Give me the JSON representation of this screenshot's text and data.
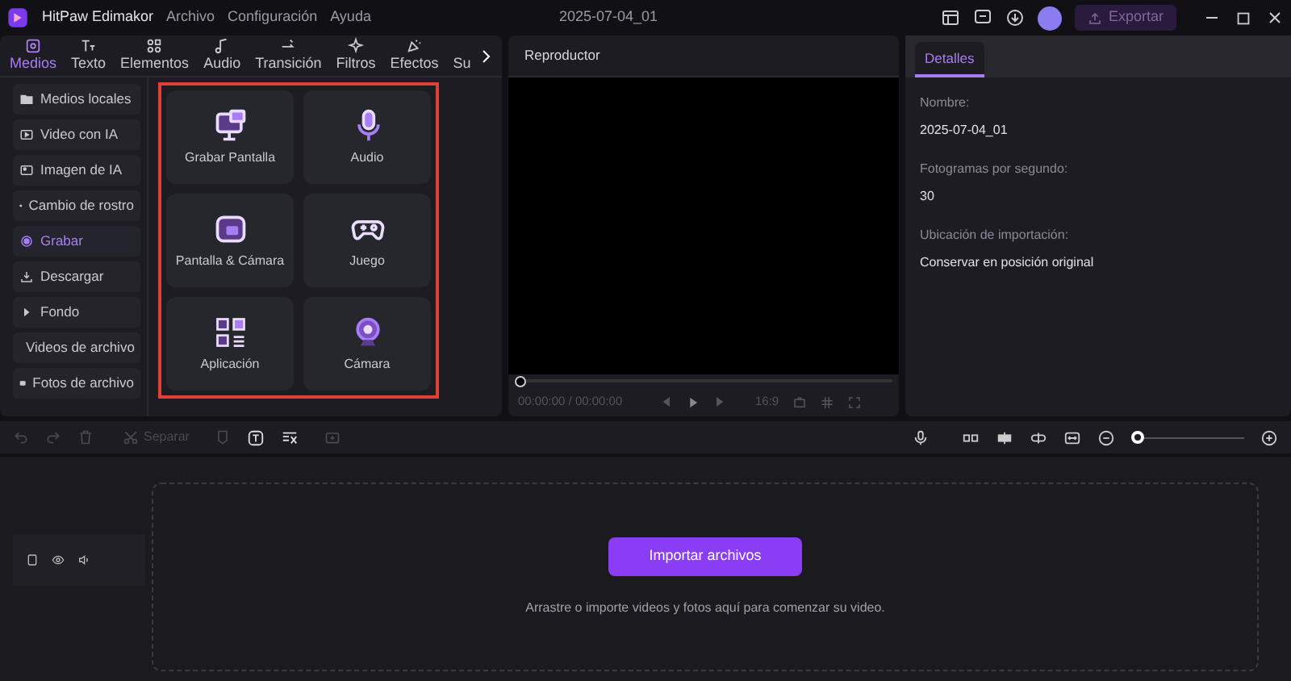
{
  "title_bar": {
    "app_name": "HitPaw Edimakor",
    "menu": [
      "Archivo",
      "Configuración",
      "Ayuda"
    ],
    "document": "2025-07-04_01",
    "export": "Exportar"
  },
  "tabs": [
    {
      "label": "Medios",
      "selected": true
    },
    {
      "label": "Texto",
      "selected": false
    },
    {
      "label": "Elementos",
      "selected": false
    },
    {
      "label": "Audio",
      "selected": false
    },
    {
      "label": "Transición",
      "selected": false
    },
    {
      "label": "Filtros",
      "selected": false
    },
    {
      "label": "Efectos",
      "selected": false
    },
    {
      "label": "Su",
      "selected": false
    }
  ],
  "sidebar": [
    {
      "label": "Medios locales",
      "selected": false
    },
    {
      "label": "Video con IA",
      "selected": false
    },
    {
      "label": "Imagen de IA",
      "selected": false
    },
    {
      "label": "Cambio de rostro",
      "selected": false
    },
    {
      "label": "Grabar",
      "selected": true
    },
    {
      "label": "Descargar",
      "selected": false
    },
    {
      "label": "Fondo",
      "selected": false
    },
    {
      "label": "Videos de archivo",
      "selected": false
    },
    {
      "label": "Fotos de archivo",
      "selected": false
    }
  ],
  "record_options": [
    {
      "label": "Grabar Pantalla",
      "kind": "screen"
    },
    {
      "label": "Audio",
      "kind": "mic"
    },
    {
      "label": "Pantalla & Cámara",
      "kind": "screencam"
    },
    {
      "label": "Juego",
      "kind": "game"
    },
    {
      "label": "Aplicación",
      "kind": "app"
    },
    {
      "label": "Cámara",
      "kind": "camera"
    }
  ],
  "player": {
    "title": "Reproductor",
    "time": "00:00:00 / 00:00:00",
    "aspect": "16:9",
    "level": 0
  },
  "details": {
    "tab": "Detalles",
    "fields": [
      {
        "label": "Nombre:",
        "value": "2025-07-04_01"
      },
      {
        "label": "Fotogramas por segundo:",
        "value": "30"
      },
      {
        "label": "Ubicación de importación:",
        "value": "Conservar en posición original"
      }
    ]
  },
  "toolbar": {
    "split": "Separar",
    "zoom": {
      "level": 0
    }
  },
  "timeline": {
    "import_button": "Importar archivos",
    "hint": "Arrastre o importe videos y fotos aquí para comenzar su video."
  }
}
